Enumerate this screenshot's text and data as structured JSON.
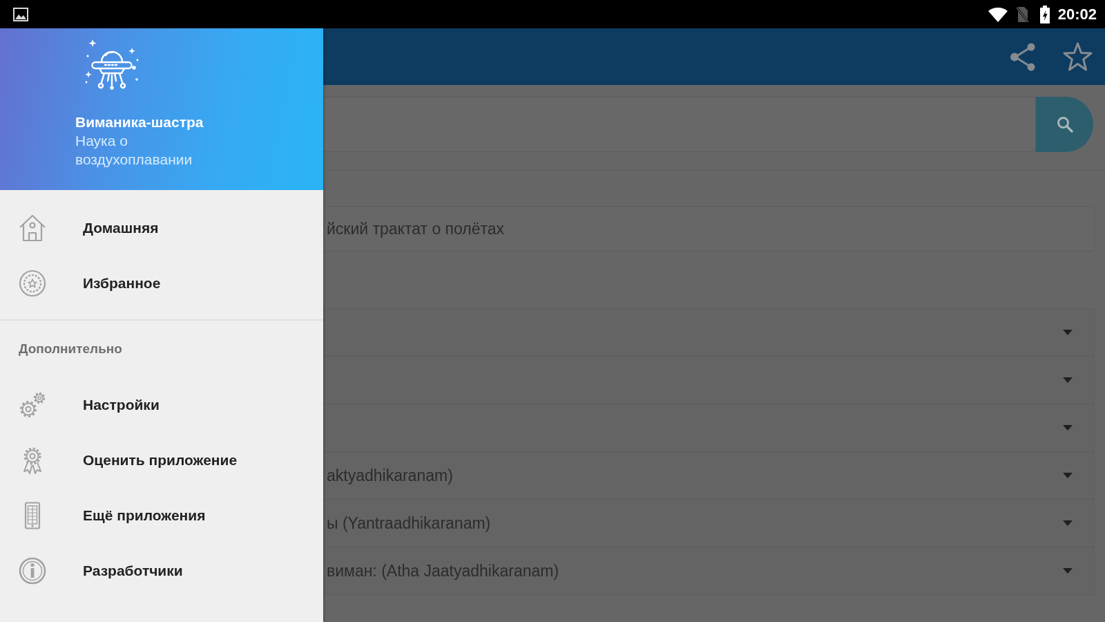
{
  "status_bar": {
    "time": "20:02"
  },
  "drawer": {
    "header": {
      "title": "Виманика-шастра",
      "subtitle": "Наука о воздухоплавании"
    },
    "items": [
      {
        "label": "Домашняя",
        "selected": false
      },
      {
        "label": "Избранное",
        "selected": false
      }
    ],
    "section": {
      "title": "Дополнительно",
      "items": [
        {
          "label": "Настройки"
        },
        {
          "label": "Оценить приложение"
        },
        {
          "label": "Ещё приложения"
        },
        {
          "label": "Разработчики"
        }
      ]
    }
  },
  "content": {
    "intro": "йский трактат о полётах",
    "chapters": [
      {
        "expanded": false
      },
      {
        "expanded": false
      },
      {
        "expanded": false
      },
      {
        "title": "aktyadhikaranam)",
        "expanded": false
      },
      {
        "title": "ы (Yantraadhikaranam)",
        "expanded": false
      },
      {
        "title": "виман: (Atha Jaatyadhikaranam)",
        "expanded": false
      }
    ]
  }
}
